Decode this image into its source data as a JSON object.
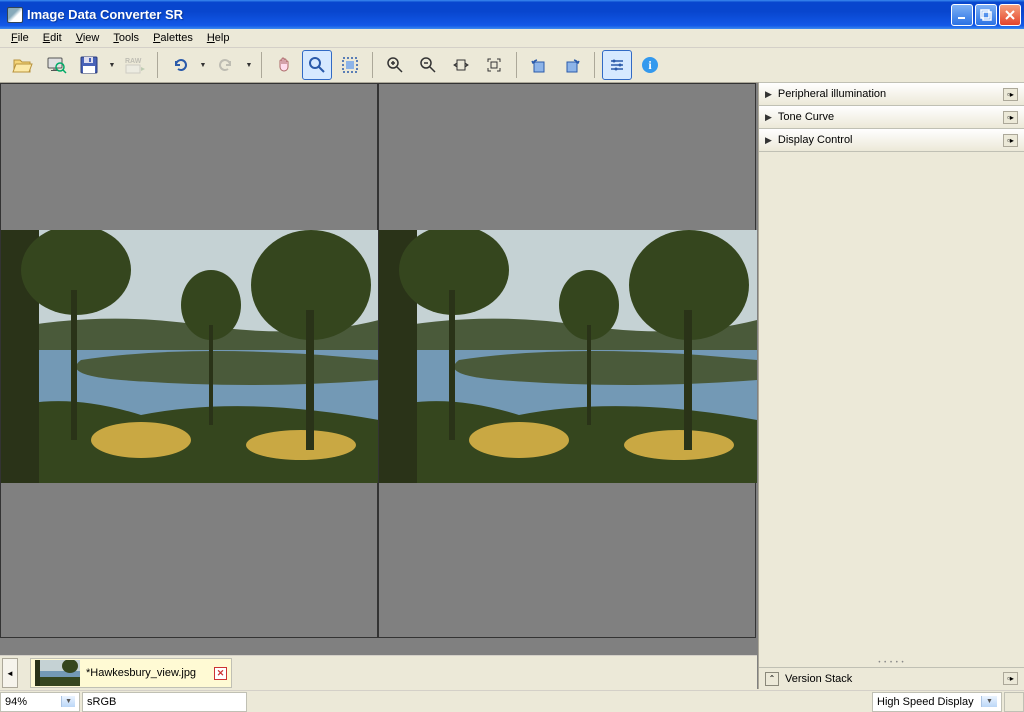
{
  "window": {
    "title": "Image Data Converter SR"
  },
  "menu": {
    "file": "File",
    "edit": "Edit",
    "view": "View",
    "tools": "Tools",
    "palettes": "Palettes",
    "help": "Help"
  },
  "panels": {
    "peripheral": "Peripheral illumination",
    "tonecurve": "Tone Curve",
    "display": "Display Control",
    "version_stack": "Version Stack"
  },
  "thumbnail": {
    "filename": "*Hawkesbury_view.jpg"
  },
  "status": {
    "zoom": "94%",
    "colorspace": "sRGB",
    "display_mode": "High Speed Display"
  }
}
